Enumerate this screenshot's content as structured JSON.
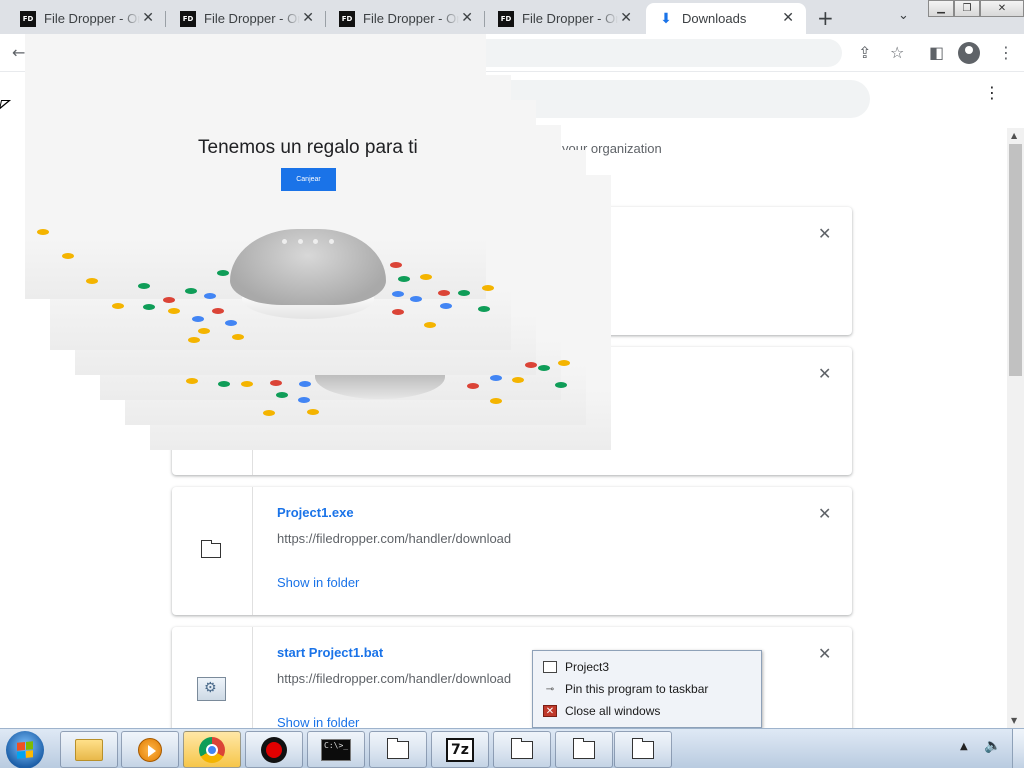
{
  "browser": {
    "tabs": [
      {
        "label": "File Dropper - Onl",
        "favicon": "FD"
      },
      {
        "label": "File Dropper - Onl",
        "favicon": "FD"
      },
      {
        "label": "File Dropper - Onl",
        "favicon": "FD"
      },
      {
        "label": "File Dropper - Onl",
        "favicon": "FD"
      },
      {
        "label": "Downloads",
        "favicon": "download-icon"
      }
    ],
    "active_tab": 4,
    "close_glyph": "✕",
    "new_tab_glyph": "+",
    "tab_search_glyph": "⌄"
  },
  "downloads_page": {
    "managed_text": "your organization",
    "items": [
      {
        "filename": "",
        "url": "",
        "action": ""
      },
      {
        "filename": "",
        "url": "",
        "action": ""
      },
      {
        "filename": "Project1.exe",
        "url": "https://filedropper.com/handler/download",
        "action": "Show in folder",
        "icon": "window-icon"
      },
      {
        "filename": "start Project1.bat",
        "url": "https://filedropper.com/handler/download",
        "action": "Show in folder",
        "icon": "batch-file-icon"
      }
    ]
  },
  "popup": {
    "headline": "Tenemos un regalo para ti",
    "button_label": "Canjear"
  },
  "jumplist": {
    "items": [
      {
        "label": "Project3",
        "icon": "window-icon"
      },
      {
        "label": "Pin this program to taskbar",
        "icon": "pin-icon"
      },
      {
        "label": "Close all windows",
        "icon": "close-all-icon"
      }
    ]
  },
  "taskbar": {
    "cmd_text": "C:\\>_",
    "sevenzip_label": "7z"
  },
  "colors": {
    "accent": "#1a73e8",
    "tabstrip": "#dee1e6",
    "taskbar": "#b9cbe0"
  }
}
